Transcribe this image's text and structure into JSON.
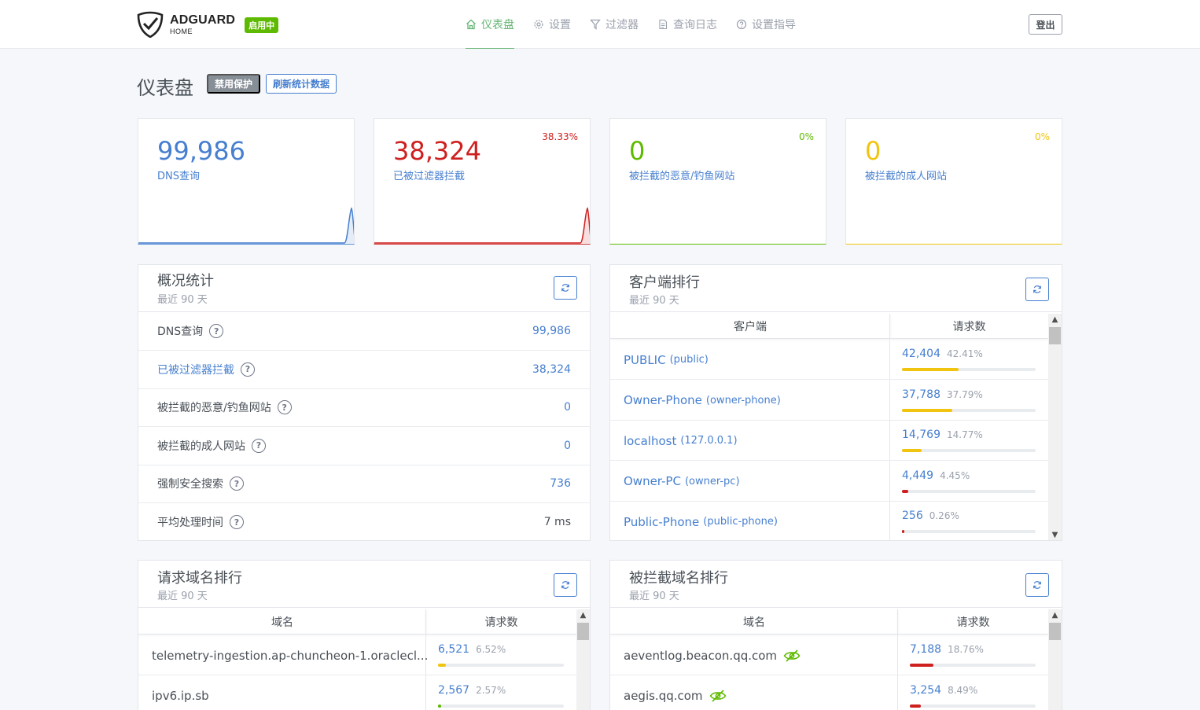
{
  "header": {
    "brand_name": "ADGUARD",
    "brand_sub": "HOME",
    "status_badge": "启用中",
    "nav": [
      {
        "label": "仪表盘",
        "icon": "home-icon",
        "active": true
      },
      {
        "label": "设置",
        "icon": "gear-icon"
      },
      {
        "label": "过滤器",
        "icon": "filter-icon"
      },
      {
        "label": "查询日志",
        "icon": "log-icon"
      },
      {
        "label": "设置指导",
        "icon": "help-icon"
      }
    ],
    "logout": "登出"
  },
  "page": {
    "title": "仪表盘",
    "disable_btn": "禁用保护",
    "refresh_btn": "刷新统计数据"
  },
  "stats": [
    {
      "value": "99,986",
      "label": "DNS查询",
      "percent": "",
      "color": "#467fcf"
    },
    {
      "value": "38,324",
      "label": "已被过滤器拦截",
      "percent": "38.33%",
      "color": "#cd201f"
    },
    {
      "value": "0",
      "label": "被拦截的恶意/钓鱼网站",
      "percent": "0%",
      "color": "#5eba00"
    },
    {
      "value": "0",
      "label": "被拦截的成人网站",
      "percent": "0%",
      "color": "#f1c40f"
    }
  ],
  "overview": {
    "title": "概况统计",
    "subtitle": "最近 90 天",
    "rows": [
      {
        "label": "DNS查询",
        "value": "99,986"
      },
      {
        "label": "已被过滤器拦截",
        "value": "38,324"
      },
      {
        "label": "被拦截的恶意/钓鱼网站",
        "value": "0"
      },
      {
        "label": "被拦截的成人网站",
        "value": "0"
      },
      {
        "label": "强制安全搜索",
        "value": "736"
      },
      {
        "label": "平均处理时间",
        "value": "7 ms"
      }
    ]
  },
  "clients": {
    "title": "客户端排行",
    "subtitle": "最近 90 天",
    "col_client": "客户端",
    "col_count": "请求数",
    "rows": [
      {
        "name": "PUBLIC",
        "id": "(public)",
        "count": "42,404",
        "percent": "42.41%",
        "fraction": 0.4241,
        "color": "#f1c40f"
      },
      {
        "name": "Owner-Phone",
        "id": "(owner-phone)",
        "count": "37,788",
        "percent": "37.79%",
        "fraction": 0.3779,
        "color": "#f1c40f"
      },
      {
        "name": "localhost",
        "id": "(127.0.0.1)",
        "count": "14,769",
        "percent": "14.77%",
        "fraction": 0.1477,
        "color": "#f1c40f"
      },
      {
        "name": "Owner-PC",
        "id": "(owner-pc)",
        "count": "4,449",
        "percent": "4.45%",
        "fraction": 0.0445,
        "color": "#cd201f"
      },
      {
        "name": "Public-Phone",
        "id": "(public-phone)",
        "count": "256",
        "percent": "0.26%",
        "fraction": 0.0026,
        "color": "#cd201f"
      }
    ]
  },
  "queried": {
    "title": "请求域名排行",
    "subtitle": "最近 90 天",
    "col_domain": "域名",
    "col_count": "请求数",
    "rows": [
      {
        "domain": "telemetry-ingestion.ap-chuncheon-1.oraclecl...",
        "count": "6,521",
        "percent": "6.52%",
        "fraction": 0.0652,
        "color": "#f1c40f"
      },
      {
        "domain": "ipv6.ip.sb",
        "count": "2,567",
        "percent": "2.57%",
        "fraction": 0.0257,
        "color": "#5eba00"
      }
    ]
  },
  "blocked": {
    "title": "被拦截域名排行",
    "subtitle": "最近 90 天",
    "col_domain": "域名",
    "col_count": "请求数",
    "rows": [
      {
        "domain": "aeventlog.beacon.qq.com",
        "count": "7,188",
        "percent": "18.76%",
        "fraction": 0.1876,
        "color": "#cd201f"
      },
      {
        "domain": "aegis.qq.com",
        "count": "3,254",
        "percent": "8.49%",
        "fraction": 0.0849,
        "color": "#cd201f"
      }
    ]
  }
}
